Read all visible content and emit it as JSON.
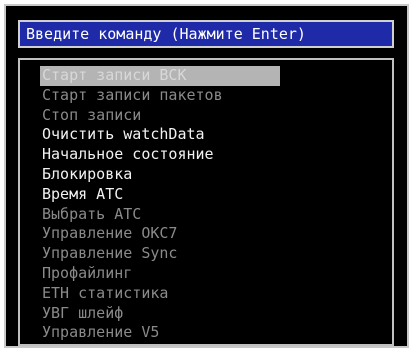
{
  "title": "Введите команду (Нажмите Enter)",
  "menu": {
    "items": [
      {
        "label": "Старт записи ВСК",
        "state": "selected"
      },
      {
        "label": "Старт записи пакетов",
        "state": "disabled"
      },
      {
        "label": "Стоп записи",
        "state": "disabled"
      },
      {
        "label": "Очистить watchData",
        "state": "enabled"
      },
      {
        "label": "Начальное состояние",
        "state": "enabled"
      },
      {
        "label": "Блокировка",
        "state": "enabled"
      },
      {
        "label": "Время АТС",
        "state": "enabled"
      },
      {
        "label": "Выбрать АТС",
        "state": "disabled"
      },
      {
        "label": "Управление ОКС7",
        "state": "disabled"
      },
      {
        "label": "Управление Sync",
        "state": "disabled"
      },
      {
        "label": "Профайлинг",
        "state": "disabled"
      },
      {
        "label": "ETH статистика",
        "state": "disabled"
      },
      {
        "label": "УВГ шлейф",
        "state": "disabled"
      },
      {
        "label": "Управление V5",
        "state": "disabled"
      }
    ]
  },
  "colors": {
    "background": "#000000",
    "title_bar": "#1f2aa8",
    "enabled_text": "#f2f2f2",
    "disabled_text": "#8a8a8a",
    "selection": "#b4b4b4"
  }
}
